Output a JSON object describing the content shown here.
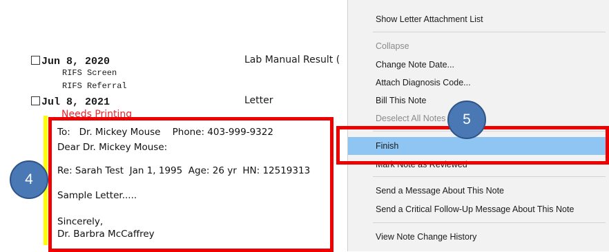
{
  "notes": [
    {
      "date": "Jun 8, 2020",
      "type": "Lab Manual Result (",
      "sub_items": [
        "RIFS Screen",
        "RIFS Referral"
      ]
    },
    {
      "date": "Jul 8, 2021",
      "type": "Letter",
      "status": "Needs Printing",
      "letter": {
        "to_line": "To:   Dr. Mickey Mouse    Phone: 403-999-9322",
        "greeting": "Dear Dr. Mickey Mouse:",
        "re_line": "Re: Sarah Test  Jan 1, 1995  Age: 26 yr  HN: 12519313",
        "body": "Sample Letter.....",
        "closing": "Sincerely,",
        "signature": "Dr. Barbra McCaffrey"
      }
    }
  ],
  "context_menu": {
    "items": [
      {
        "label": "Show Letter Attachment List",
        "enabled": true
      },
      {
        "label": "Collapse",
        "enabled": false
      },
      {
        "label": "Change Note Date...",
        "enabled": true
      },
      {
        "label": "Attach Diagnosis Code...",
        "enabled": true
      },
      {
        "label": "Bill This Note",
        "enabled": true
      },
      {
        "label": "Deselect All Notes",
        "enabled": false
      },
      {
        "label": "Finish",
        "enabled": true,
        "highlighted": true
      },
      {
        "label": "Mark Note as Reviewed",
        "enabled": true
      },
      {
        "label": "Send a Message About This Note",
        "enabled": true
      },
      {
        "label": "Send a Critical Follow-Up Message About This Note",
        "enabled": true
      },
      {
        "label": "View Note Change History",
        "enabled": true
      }
    ]
  },
  "callouts": {
    "four": "4",
    "five": "5"
  },
  "colors": {
    "annotation_red": "#ee0000",
    "highlight_blue": "#8fc5f3",
    "callout_blue": "#4a78b5",
    "needs_printing_red": "#e8262c",
    "marker_yellow": "#ffff00"
  }
}
